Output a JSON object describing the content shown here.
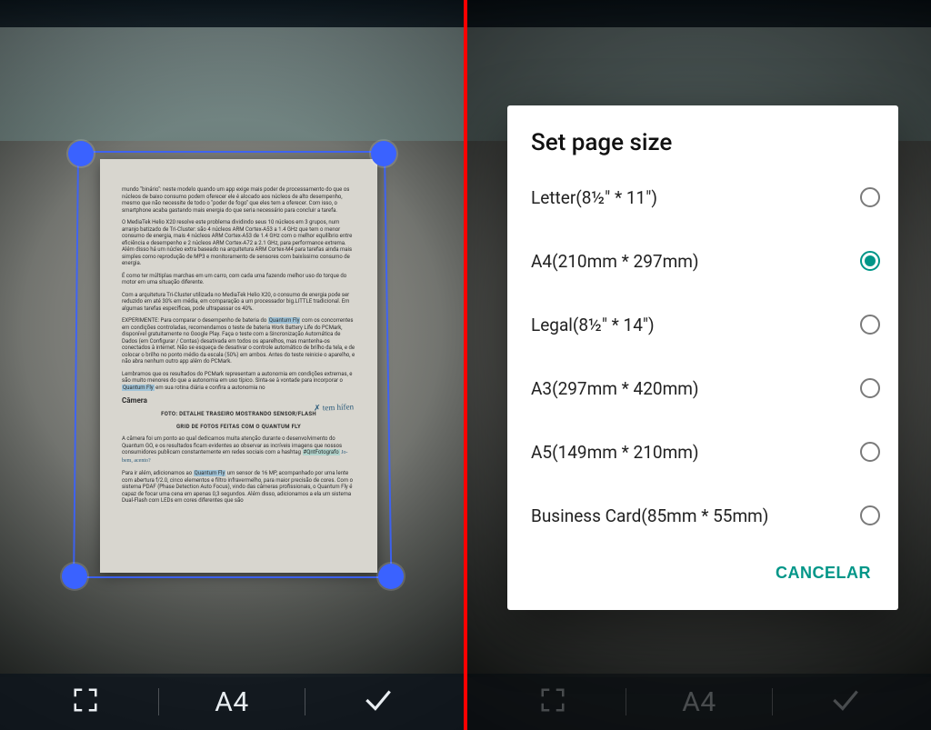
{
  "left": {
    "toolbar": {
      "page_size_label": "A4"
    },
    "crop_handles": [
      "tl",
      "tr",
      "bl",
      "br"
    ],
    "document_text": {
      "p1": "mundo \"binário\": neste modelo quando um app exige mais poder de processamento do que os núcleos de baixo consumo podem oferecer ele é alocado aos núcleos de alto desempenho, mesmo que não necessite de todo o \"poder de fogo\" que eles tem a oferecer. Com isso, o smartphone acaba gastando mais energia do que seria necessário para concluir a tarefa.",
      "p2": "O MediaTek Helio X20 resolve este problema dividindo seus 10 núcleos em 3 grupos, num arranjo batizado de Tri-Cluster: são 4 núcleos ARM Cortex-A53 a 1.4 GHz que tem o menor consumo de energia, mais 4 núcleos ARM Cortex-A53 de 1.4 GHz com o melhor equilíbrio entre eficiência e desempenho e 2 núcleos ARM Cortex-A72 a 2.1 GHz, para performance extrema. Além disso há um núcleo extra baseado na arquitetura ARM Cortex-M4 para tarefas ainda mais simples como reprodução de MP3 e monitoramento de sensores com baixíssimo consumo de energia.",
      "p3": "É como ter múltiplas marchas em um carro, com cada uma fazendo melhor uso do torque do motor em uma situação diferente.",
      "p4": "Com a arquitetura Tri-Cluster utilizada no MediaTek Helio X20, o consumo de energia pode ser reduzido em até 30% em média, em comparação a um processador big.LITTLE tradicional. Em algumas tarefas específicas, pode ultrapassar os 40%.",
      "p5_a": "EXPERIMENTE: Para comparar o desempenho de bateria do ",
      "p5_hl": "Quantum Fly",
      "p5_b": " com os concorrentes em condições controladas, recomendamos o teste de bateria Work Battery Life do PCMark, disponível gratuitamente no Google Play. Faça o teste com a Sincronização Automática de Dados (em Configurar / Contas) desativada em todos os aparelhos, mas mantenha-os conectados à internet. Não se esqueça de desativar o controle automático de brilho da tela, e de colocar o brilho no ponto médio da escala (50%) em ambos. Antes do teste reinicie o aparelho, e não abra nenhum outro app além do PCMark.",
      "p6_a": "Lembramos que os resultados do PCMark representam a autonomia em condições extremas, e são muito menores do que a autonomia em uso típico. Sinta-se à vontade para incorporar o ",
      "p6_hl": "Quantum Fly",
      "p6_b": " em sua rotina diária e confira a autonomia no",
      "hand": "✗ tem hífen",
      "h_camera": "Câmera",
      "h_foto": "FOTO: DETALHE TRASEIRO MOSTRANDO SENSOR/FLASH",
      "h_grid": "GRID DE FOTOS FEITAS COM O QUANTUM FLY",
      "p7_a": "A câmera foi um ponto ao qual dedicamos muita atenção durante o desenvolvimento do Quantum GO, e os resultados ficam evidentes ao observar as incríveis imagens que nossos consumidores publicam constantemente em redes sociais com a hashtag ",
      "p7_hl": "#QntFotografo",
      "p7_hand": " Jo-bem, acento?",
      "p8_a": "Para ir além, adicionamos ao ",
      "p8_hl": "Quantum Fly",
      "p8_b": " um sensor de 16 MP, acompanhado por uma lente com abertura f/2.0, cinco elementos e filtro infravermelho, para maior precisão de cores. Com o sistema PDAF (Phase Detection Auto Focus), vindo das câmeras profissionais, o Quantum Fly é capaz de focar uma cena em apenas 0,3 segundos. Além disso, adicionamos a ela um sistema Dual-Flash com LEDs em cores diferentes que são"
    }
  },
  "right": {
    "toolbar": {
      "page_size_label": "A4"
    },
    "modal": {
      "title": "Set page size",
      "cancel_label": "CANCELAR",
      "selected_index": 1,
      "options": [
        {
          "label": "Letter(8½\" * 11\")"
        },
        {
          "label": "A4(210mm * 297mm)"
        },
        {
          "label": "Legal(8½\" * 14\")"
        },
        {
          "label": "A3(297mm * 420mm)"
        },
        {
          "label": "A5(149mm * 210mm)"
        },
        {
          "label": "Business Card(85mm * 55mm)"
        }
      ]
    }
  }
}
